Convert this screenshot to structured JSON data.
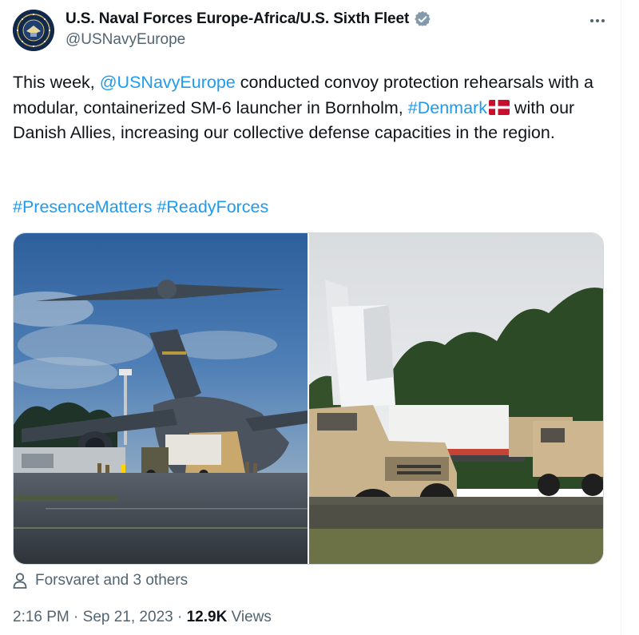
{
  "author": {
    "display_name": "U.S. Naval Forces Europe-Africa/U.S. Sixth Fleet",
    "handle": "@USNavyEurope",
    "verified_icon": "verified-badge-icon",
    "avatar_icon": "naval-seal-icon"
  },
  "tweet": {
    "text_part1": "This week, ",
    "mention": "@USNavyEurope",
    "text_part2": " conducted convoy protection rehearsals with a modular, containerized SM-6 launcher in Bornholm, ",
    "hashtag_denmark": "#Denmark",
    "flag_icon": "denmark-flag-icon",
    "text_part3": " with our Danish Allies, increasing our collective defense capacities in the region.",
    "hashtag1": "#PresenceMatters",
    "hashtag2": "#ReadyForces"
  },
  "media": {
    "images": [
      "c17-aircraft-loading-photo",
      "humvee-launcher-photo"
    ]
  },
  "tagged": {
    "label": "Forsvaret and 3 others",
    "icon": "person-icon"
  },
  "meta": {
    "time": "2:16 PM",
    "sep": " · ",
    "date": "Sep 21, 2023",
    "views_count": "12.9K",
    "views_label": " Views"
  },
  "colors": {
    "link": "#1d9bf0",
    "text": "#0f1419",
    "secondary": "#536471",
    "border": "#cfd9de"
  }
}
